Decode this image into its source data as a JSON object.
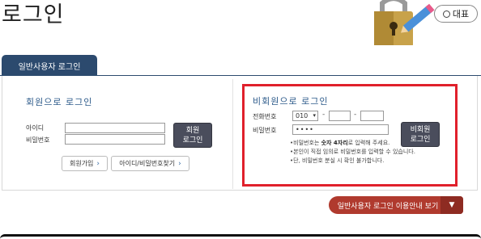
{
  "page": {
    "title": "로그인"
  },
  "header": {
    "representative_label": "대표"
  },
  "tabs": [
    {
      "label": "일반사용자 로그인"
    }
  ],
  "member_login": {
    "title": "회원으로 로그인",
    "id_label": "아이디",
    "password_label": "비밀번호",
    "login_button": {
      "line1": "회원",
      "line2": "로그인"
    },
    "signup_button": "회원가입",
    "find_button": "아이디/비밀번호찾기"
  },
  "guest_login": {
    "title": "비회원으로 로그인",
    "phone_label": "전화번호",
    "phone_prefix": "010",
    "password_label": "비밀번호",
    "password_value": "••••",
    "login_button": {
      "line1": "비회원",
      "line2": "로그인"
    },
    "notice_1_prefix": "•비밀번호는 ",
    "notice_1_bold": "숫자 4자리",
    "notice_1_suffix": "로 입력해 주세요.",
    "notice_2": "•본인이 직접 임의로 비밀번호를 입력할 수 있습니다.",
    "notice_3": "•단, 비밀번호 분실 시 확인 불가합니다."
  },
  "footer": {
    "guide_button": "일반사용자 로그인 이용안내 보기"
  },
  "colors": {
    "accent": "#2c4a6e",
    "highlight": "#e0202b",
    "guide": "#b03a2e"
  },
  "icons": {
    "lock": "padlock-pencil-illustration",
    "chevron": "chevron-right-icon",
    "dropdown": "chevron-down-icon"
  }
}
